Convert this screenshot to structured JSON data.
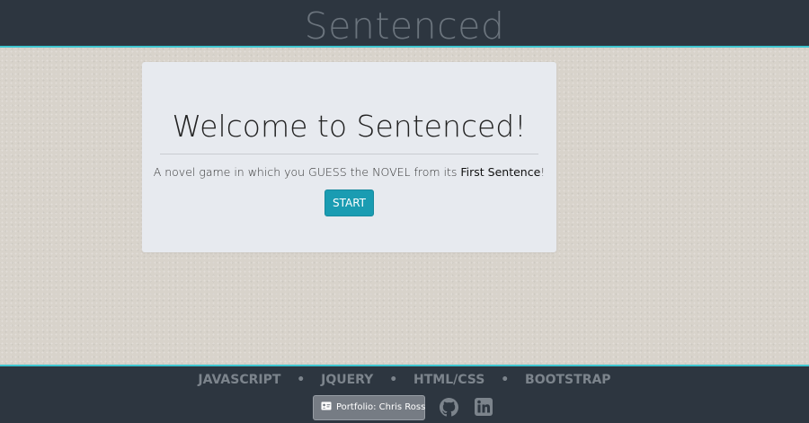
{
  "header": {
    "title": "Sentenced"
  },
  "card": {
    "title": "Welcome to Sentenced!",
    "text_before": "A novel game in which you GUESS the NOVEL from its ",
    "text_emphasis": "First Sentence",
    "text_after": "!",
    "start_label": "START"
  },
  "footer": {
    "tech": [
      "JAVASCRIPT",
      "JQUERY",
      "HTML/CSS",
      "BOOTSTRAP"
    ],
    "separator": "•",
    "portfolio_label": "Portfolio: Chris Ross",
    "icons": {
      "portfolio": "id-card-icon",
      "github": "github-icon",
      "linkedin": "linkedin-icon"
    }
  },
  "colors": {
    "header_bg": "#2d3640",
    "accent": "#3ec5cf",
    "start_button": "#1a9cb2",
    "page_bg": "#d8d3cb",
    "card_bg": "#e7eaef"
  }
}
